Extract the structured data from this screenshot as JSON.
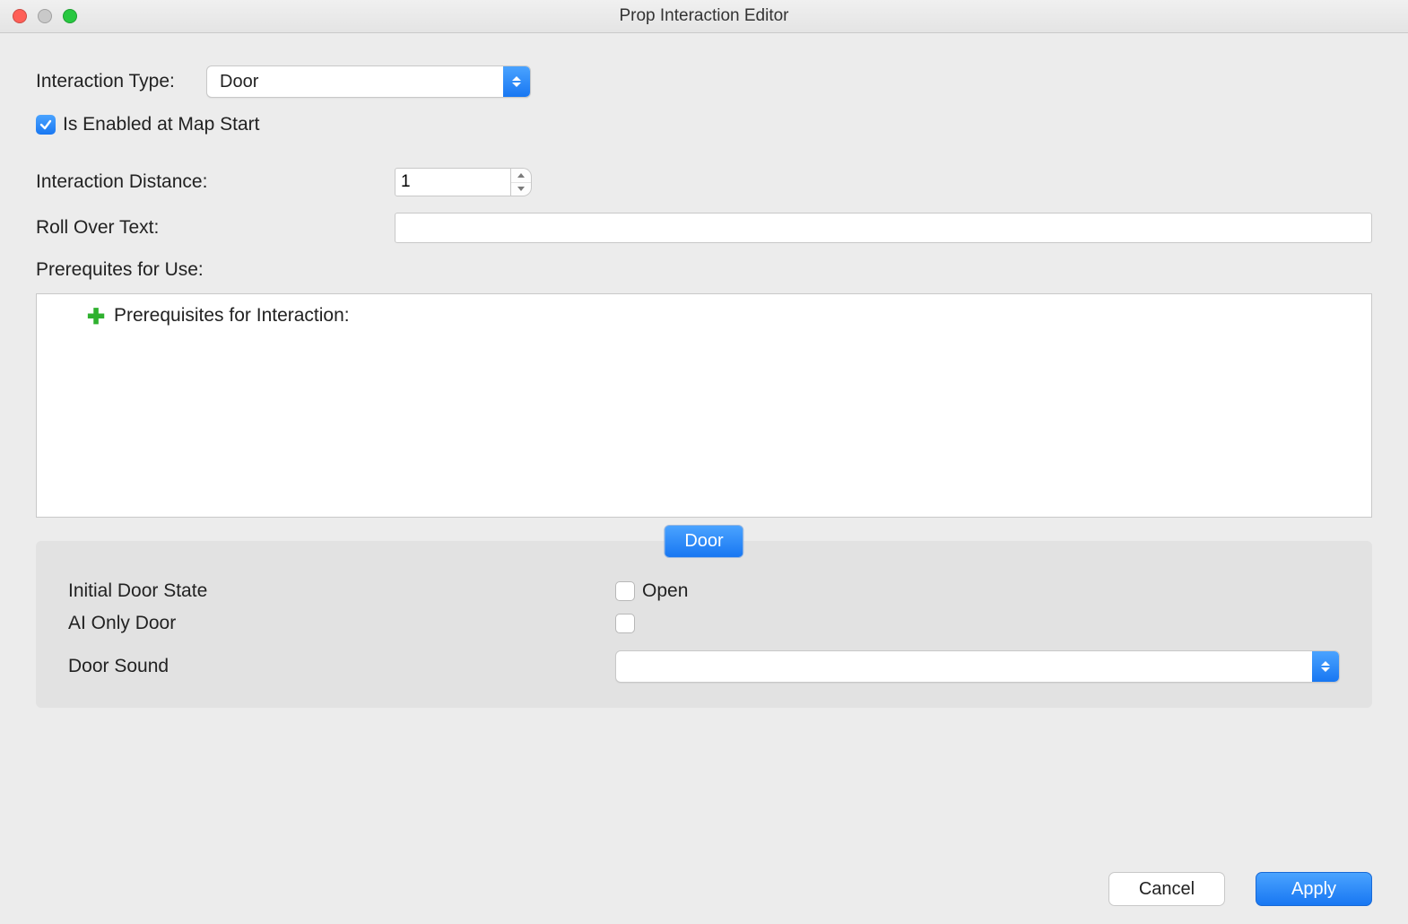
{
  "window": {
    "title": "Prop Interaction Editor"
  },
  "form": {
    "interaction_type_label": "Interaction Type:",
    "interaction_type_value": "Door",
    "enabled_label": "Is Enabled at Map Start",
    "enabled_checked": true,
    "distance_label": "Interaction Distance:",
    "distance_value": "1",
    "rollover_label": "Roll Over Text:",
    "rollover_value": "",
    "prereq_label": "Prerequites for Use:",
    "prereq_box_header": "Prerequisites for Interaction:"
  },
  "panel": {
    "tab_label": "Door",
    "initial_state_label": "Initial Door State",
    "initial_state_option": "Open",
    "initial_state_checked": false,
    "ai_only_label": "AI Only Door",
    "ai_only_checked": false,
    "sound_label": "Door Sound",
    "sound_value": ""
  },
  "footer": {
    "cancel": "Cancel",
    "apply": "Apply"
  }
}
